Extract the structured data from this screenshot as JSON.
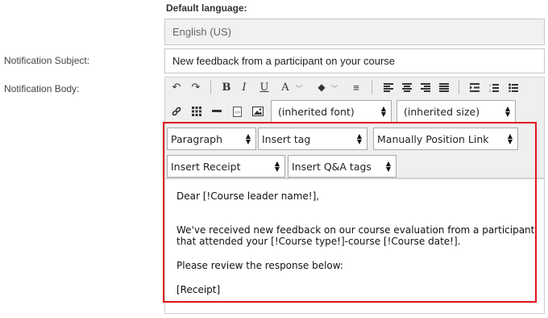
{
  "form": {
    "default_language_label": "Default language:",
    "default_language_value": "English (US)",
    "subject_label": "Notification Subject:",
    "subject_value": "New feedback from a participant on your course",
    "body_label": "Notification Body:"
  },
  "toolbar": {
    "row1": {
      "undo": "↶",
      "redo": "↷",
      "bold": "B",
      "italic": "I",
      "underline": "U",
      "font_color": "A",
      "bg_color": "◆",
      "clear_format": "≡",
      "dropdown_caret": "﹀"
    },
    "font_select": "(inherited font)",
    "size_select": "(inherited size)",
    "paragraph_select": "Paragraph",
    "insert_tag_select": "Insert tag",
    "manual_link_select": "Manually Position Link",
    "insert_receipt_select": "Insert Receipt",
    "insert_qa_select": "Insert Q&A tags"
  },
  "editor": {
    "line1": "Dear [!Course leader name!],",
    "line2": "We've received new feedback on our course evaluation from a participant",
    "line3": "that attended your [!Course type!]-course [!Course date!].",
    "line4": "Please review the response below:",
    "line5": "[Receipt]"
  },
  "colors": {
    "highlight": "#e0141c"
  }
}
